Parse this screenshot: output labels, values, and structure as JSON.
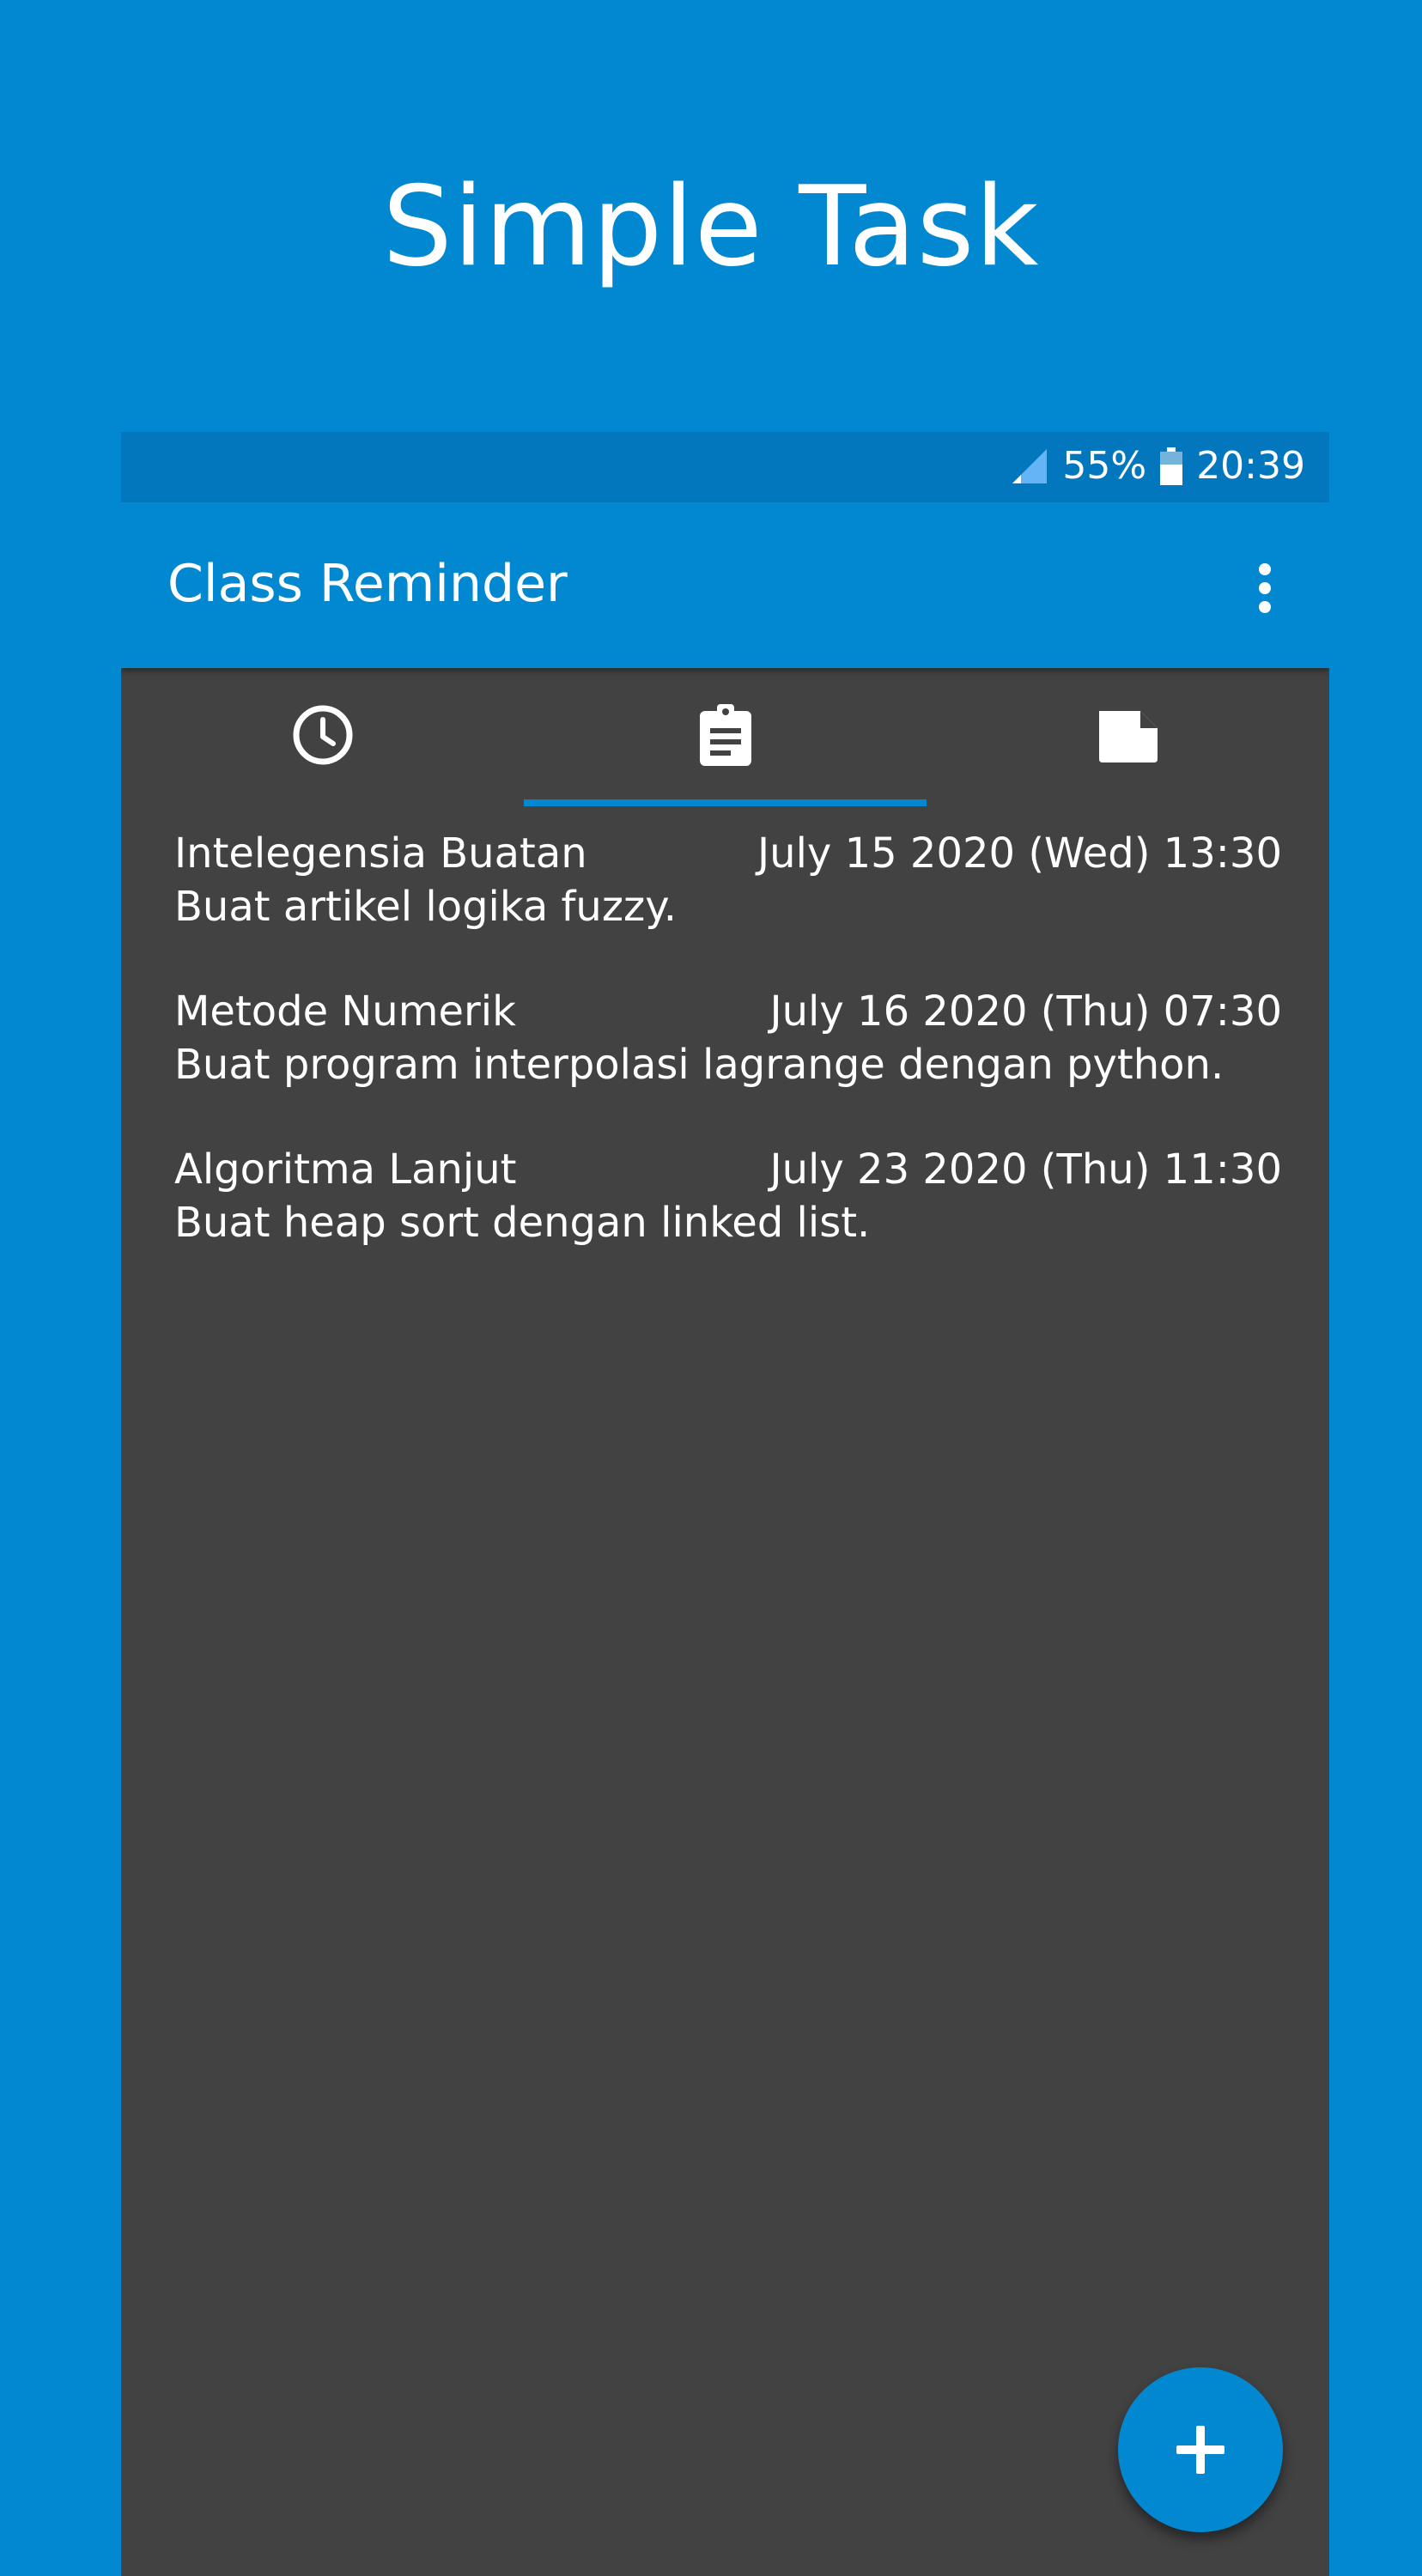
{
  "promo": {
    "title": "Simple Task"
  },
  "status_bar": {
    "battery": "55%",
    "time": "20:39"
  },
  "app_bar": {
    "title": "Class Reminder",
    "menu_icon": "more-vert-icon"
  },
  "tabs": [
    {
      "icon": "clock-icon",
      "selected": false
    },
    {
      "icon": "clipboard-icon",
      "selected": true
    },
    {
      "icon": "note-icon",
      "selected": false
    }
  ],
  "tasks": [
    {
      "subject": "Intelegensia Buatan",
      "datetime": "July 15 2020 (Wed) 13:30",
      "description": "Buat artikel logika fuzzy."
    },
    {
      "subject": "Metode Numerik",
      "datetime": "July 16 2020 (Thu) 07:30",
      "description": "Buat program interpolasi lagrange dengan python."
    },
    {
      "subject": "Algoritma Lanjut",
      "datetime": "July 23 2020 (Thu) 11:30",
      "description": "Buat heap sort dengan linked list."
    }
  ],
  "fab": {
    "icon": "plus-icon"
  },
  "colors": {
    "primary": "#0288d1",
    "primary_dark": "#0277bd",
    "content_bg": "#424242",
    "text": "#ffffff"
  }
}
